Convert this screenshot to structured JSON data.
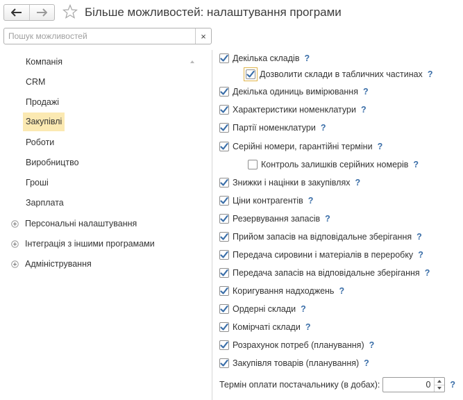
{
  "header": {
    "title": "Більше можливостей: налаштування програми"
  },
  "search": {
    "placeholder": "Пошук можливостей",
    "value": "",
    "clear_label": "×"
  },
  "nav": {
    "items": [
      {
        "label": "Компанія"
      },
      {
        "label": "CRM"
      },
      {
        "label": "Продажі"
      },
      {
        "label": "Закупівлі",
        "selected": true
      },
      {
        "label": "Роботи"
      },
      {
        "label": "Виробництво"
      },
      {
        "label": "Гроші"
      },
      {
        "label": "Зарплата"
      }
    ],
    "groups": [
      {
        "label": "Персональні налаштування"
      },
      {
        "label": "Інтеграція з іншими програмами"
      },
      {
        "label": "Адміністрування"
      }
    ]
  },
  "options": [
    {
      "label": "Декілька складів",
      "checked": true,
      "help": "?"
    },
    {
      "label": "Дозволити склади в табличних частинах",
      "checked": true,
      "help": "?"
    },
    {
      "label": "Декілька одиниць вимірювання",
      "checked": true,
      "help": "?"
    },
    {
      "label": "Характеристики номенклатури",
      "checked": true,
      "help": "?"
    },
    {
      "label": "Партії номенклатури",
      "checked": true,
      "help": "?"
    },
    {
      "label": "Серійні номери, гарантійні терміни",
      "checked": true,
      "help": "?"
    },
    {
      "label": "Контроль залишків серійних номерів",
      "checked": false,
      "help": "?"
    },
    {
      "label": "Знижки і націнки в закупівлях",
      "checked": true,
      "help": "?"
    },
    {
      "label": "Ціни контрагентів",
      "checked": true,
      "help": "?"
    },
    {
      "label": "Резервування запасів",
      "checked": true,
      "help": "?"
    },
    {
      "label": "Прийом запасів на відповідальне зберігання",
      "checked": true,
      "help": "?"
    },
    {
      "label": "Передача сировини і матеріалів в переробку",
      "checked": true,
      "help": "?"
    },
    {
      "label": "Передача запасів на відповідальне зберігання",
      "checked": true,
      "help": "?"
    },
    {
      "label": "Коригування надходжень",
      "checked": true,
      "help": "?"
    },
    {
      "label": "Ордерні склади",
      "checked": true,
      "help": "?"
    },
    {
      "label": "Комірчаті склади",
      "checked": true,
      "help": "?"
    },
    {
      "label": "Розрахунок потреб (планування)",
      "checked": true,
      "help": "?"
    },
    {
      "label": "Закупівля товарів (планування)",
      "checked": true,
      "help": "?"
    }
  ],
  "payment_term": {
    "label": "Термін оплати постачальнику (в добах):",
    "value": "0",
    "help": "?"
  },
  "colors": {
    "accent_check": "#3a6ea8",
    "selected_bg": "#fbe9b2",
    "help": "#3a6ea8"
  },
  "icons": {
    "back": "arrow-left-icon",
    "forward": "arrow-right-icon",
    "favorite": "star-icon",
    "expand": "plus-icon",
    "scroll": "scroll-up-icon"
  }
}
